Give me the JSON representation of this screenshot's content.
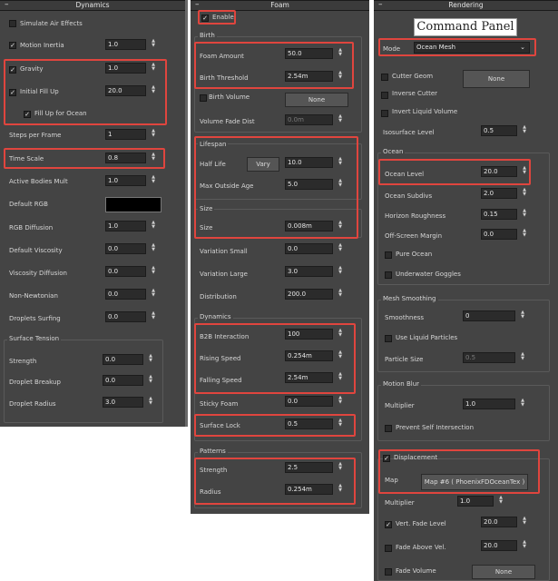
{
  "dynamics": {
    "title": "Dynamics",
    "simulate_air_effects": "Simulate Air Effects",
    "motion_inertia": {
      "label": "Motion Inertia",
      "value": "1.0"
    },
    "gravity": {
      "label": "Gravity",
      "value": "1.0"
    },
    "initial_fill_up": {
      "label": "Initial Fill Up",
      "value": "20.0"
    },
    "fill_up_for_ocean": "Fill Up for Ocean",
    "steps_per_frame": {
      "label": "Steps per Frame",
      "value": "1"
    },
    "time_scale": {
      "label": "Time Scale",
      "value": "0.8"
    },
    "active_bodies_mult": {
      "label": "Active Bodies Mult",
      "value": "1.0"
    },
    "default_rgb": {
      "label": "Default RGB",
      "color": "#000000"
    },
    "rgb_diffusion": {
      "label": "RGB Diffusion",
      "value": "1.0"
    },
    "default_viscosity": {
      "label": "Default Viscosity",
      "value": "0.0"
    },
    "viscosity_diffusion": {
      "label": "Viscosity Diffusion",
      "value": "0.0"
    },
    "non_newtonian": {
      "label": "Non-Newtonian",
      "value": "0.0"
    },
    "droplets_surfing": {
      "label": "Droplets Surfing",
      "value": "0.0"
    },
    "surface_tension": {
      "title": "Surface Tension",
      "strength": {
        "label": "Strength",
        "value": "0.0"
      },
      "droplet_breakup": {
        "label": "Droplet Breakup",
        "value": "0.0"
      },
      "droplet_radius": {
        "label": "Droplet Radius",
        "value": "3.0"
      }
    }
  },
  "foam": {
    "title": "Foam",
    "enable": "Enable",
    "birth": {
      "title": "Birth",
      "foam_amount": {
        "label": "Foam Amount",
        "value": "50.0"
      },
      "birth_threshold": {
        "label": "Birth Threshold",
        "value": "2.54m"
      },
      "birth_volume": {
        "label": "Birth Volume",
        "button": "None"
      },
      "volume_fade_dist": {
        "label": "Volume Fade Dist",
        "value": "0.0m"
      }
    },
    "lifespan": {
      "title": "Lifespan",
      "half_life": {
        "label": "Half Life",
        "button": "Vary",
        "value": "10.0"
      },
      "max_outside_age": {
        "label": "Max Outside Age",
        "value": "5.0"
      }
    },
    "size_group": {
      "title": "Size",
      "size": {
        "label": "Size",
        "value": "0.008m"
      },
      "variation_small": {
        "label": "Variation Small",
        "value": "0.0"
      },
      "variation_large": {
        "label": "Variation Large",
        "value": "3.0"
      },
      "distribution": {
        "label": "Distribution",
        "value": "200.0"
      }
    },
    "dynamics_group": {
      "title": "Dynamics",
      "b2b_interaction": {
        "label": "B2B Interaction",
        "value": "100"
      },
      "rising_speed": {
        "label": "Rising Speed",
        "value": "0.254m"
      },
      "falling_speed": {
        "label": "Falling Speed",
        "value": "2.54m"
      },
      "sticky_foam": {
        "label": "Sticky Foam",
        "value": "0.0"
      },
      "surface_lock": {
        "label": "Surface Lock",
        "value": "0.5"
      }
    },
    "patterns": {
      "title": "Patterns",
      "strength": {
        "label": "Strength",
        "value": "2.5"
      },
      "radius": {
        "label": "Radius",
        "value": "0.254m"
      }
    }
  },
  "rendering": {
    "title": "Rendering",
    "command_panel": "Command Panel",
    "mode": {
      "label": "Mode",
      "value": "Ocean Mesh"
    },
    "cutter_geom": {
      "label": "Cutter Geom",
      "button": "None"
    },
    "inverse_cutter": "Inverse Cutter",
    "invert_liquid_volume": "Invert Liquid Volume",
    "isosurface_level": {
      "label": "Isosurface Level",
      "value": "0.5"
    },
    "ocean": {
      "title": "Ocean",
      "ocean_level": {
        "label": "Ocean Level",
        "value": "20.0"
      },
      "ocean_subdivs": {
        "label": "Ocean Subdivs",
        "value": "2.0"
      },
      "horizon_roughness": {
        "label": "Horizon Roughness",
        "value": "0.15"
      },
      "off_screen_margin": {
        "label": "Off-Screen Margin",
        "value": "0.0"
      },
      "pure_ocean": "Pure Ocean",
      "underwater_goggles": "Underwater Goggles"
    },
    "mesh_smoothing": {
      "title": "Mesh Smoothing",
      "smoothness": {
        "label": "Smoothness",
        "value": "0"
      },
      "use_liquid_particles": "Use Liquid Particles",
      "particle_size": {
        "label": "Particle Size",
        "value": "0.5"
      }
    },
    "motion_blur": {
      "title": "Motion Blur",
      "multiplier": {
        "label": "Multiplier",
        "value": "1.0"
      },
      "prevent_self_intersection": "Prevent Self Intersection"
    },
    "displacement": {
      "label": "Displacement",
      "map": {
        "label": "Map",
        "button": "Map #6  ( PhoenixFDOceanTex )"
      },
      "multiplier": {
        "label": "Multiplier",
        "value": "1.0"
      },
      "vert_fade_level": {
        "label": "Vert. Fade Level",
        "value": "20.0"
      },
      "fade_above_vel": {
        "label": "Fade Above Vel.",
        "value": "20.0"
      },
      "fade_volume": {
        "label": "Fade Volume",
        "button": "None"
      }
    }
  },
  "colors": {
    "highlight": "#e0453e",
    "panel_bg": "#444444",
    "field_bg": "#2b2b2b"
  }
}
